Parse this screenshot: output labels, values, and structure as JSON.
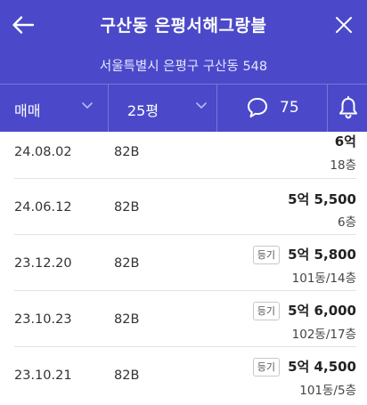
{
  "header": {
    "title": "구산동 은평서해그랑블",
    "address": "서울특별시 은평구 구산동 548",
    "bg_color": "#4b49c9"
  },
  "filters": {
    "trade_type": "매매",
    "size": "25평",
    "comment_count": "75"
  },
  "icons": {
    "back": "back-arrow-icon",
    "close": "close-icon",
    "comment": "chat-bubble-icon",
    "alert": "bell-icon",
    "dropdown": "chevron-down-icon"
  },
  "transactions": [
    {
      "date": "24.08.02",
      "type": "82B",
      "price": "6억",
      "floor": "18층",
      "badge": ""
    },
    {
      "date": "24.06.12",
      "type": "82B",
      "price": "5억 5,500",
      "floor": "6층",
      "badge": ""
    },
    {
      "date": "23.12.20",
      "type": "82B",
      "price": "5억 5,800",
      "floor": "101동/14층",
      "badge": "등기"
    },
    {
      "date": "23.10.23",
      "type": "82B",
      "price": "5억 6,000",
      "floor": "102동/17층",
      "badge": "등기"
    },
    {
      "date": "23.10.21",
      "type": "82B",
      "price": "5억 4,500",
      "floor": "101동/5층",
      "badge": "등기"
    }
  ]
}
